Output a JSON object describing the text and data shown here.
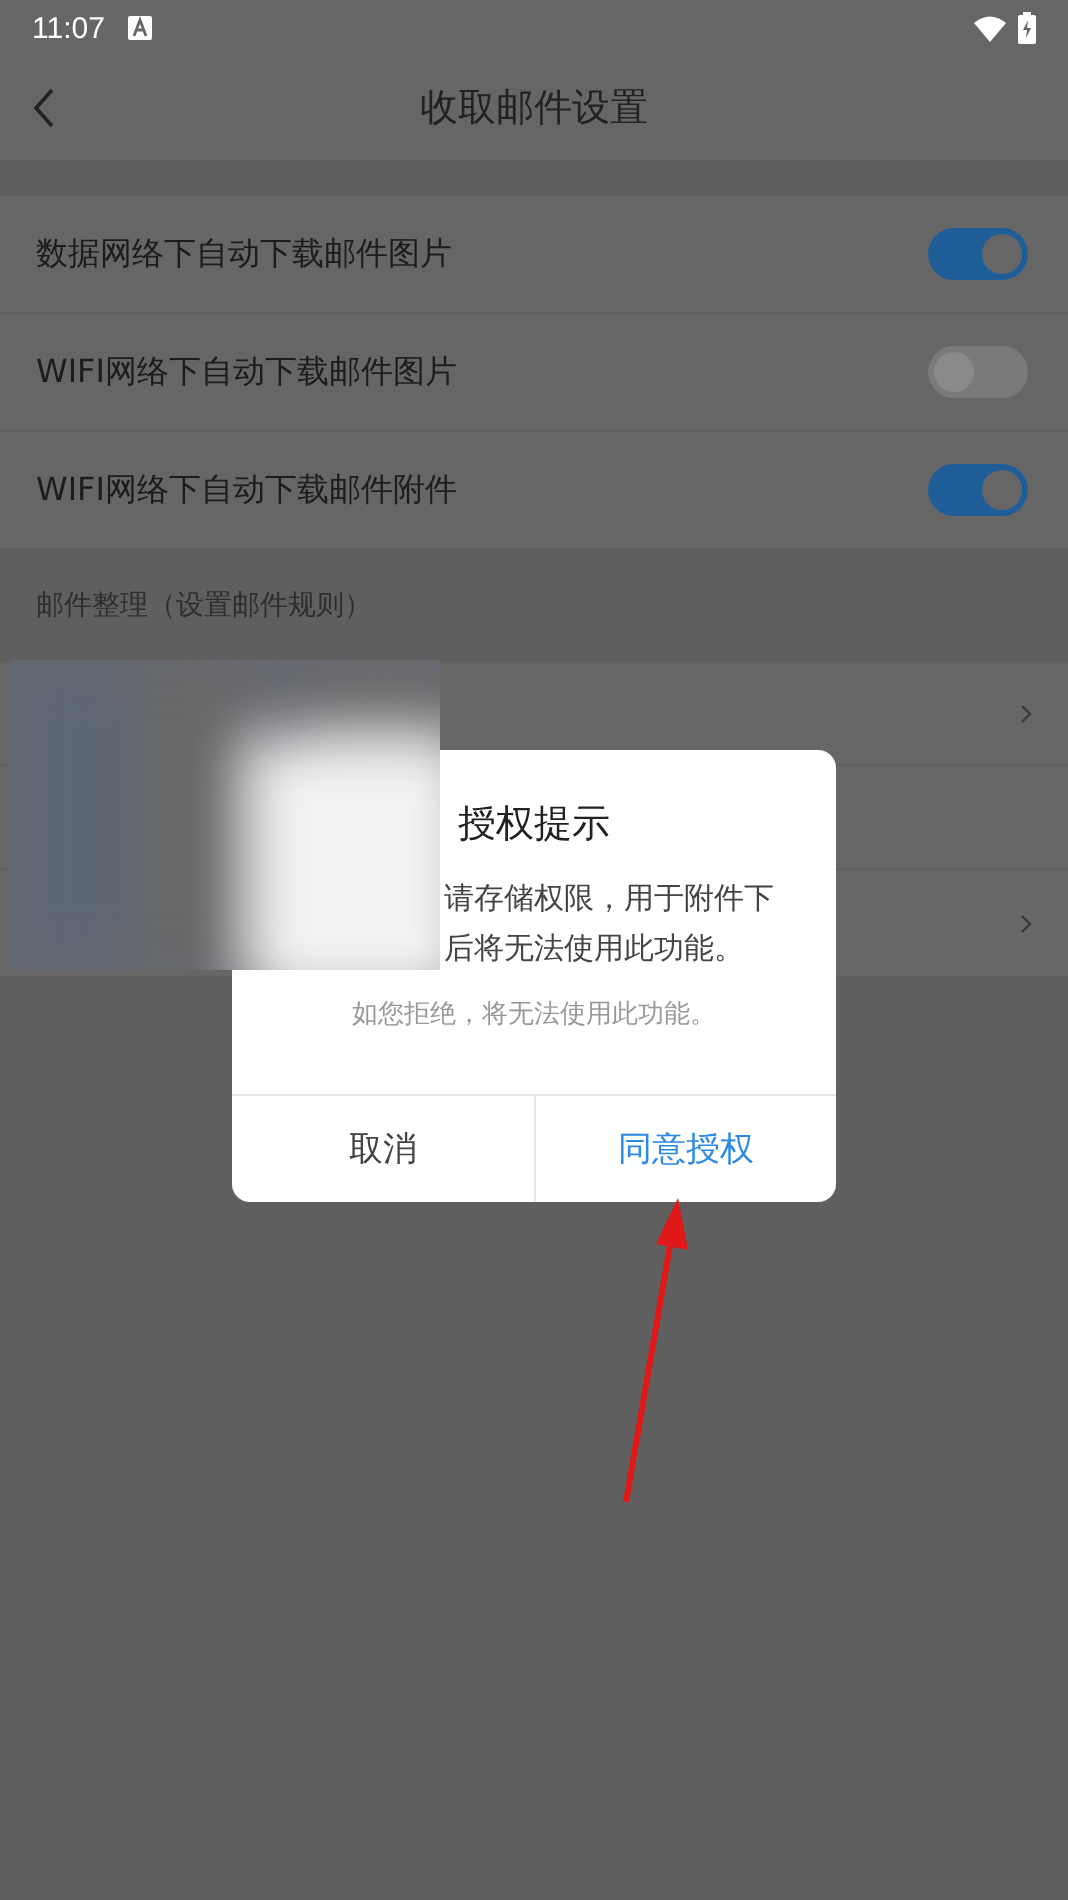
{
  "status_bar": {
    "time": "11:07"
  },
  "header": {
    "title": "收取邮件设置"
  },
  "toggles": [
    {
      "label": "数据网络下自动下载邮件图片",
      "on": true
    },
    {
      "label": "WIFI网络下自动下载邮件图片",
      "on": false
    },
    {
      "label": "WIFI网络下自动下载邮件附件",
      "on": true
    }
  ],
  "section": {
    "title": "邮件整理（设置邮件规则）"
  },
  "rule_rows": [
    {
      "kind": "link"
    },
    {
      "kind": "plain"
    },
    {
      "kind": "link"
    }
  ],
  "dialog": {
    "title": "授权提示",
    "message_lines": [
      "请存储权限，用于附件下",
      "后将无法使用此功能。"
    ],
    "note": "如您拒绝，将无法使用此功能。",
    "buttons": [
      {
        "label": "取消",
        "kind": "cancel"
      },
      {
        "label": "同意授权",
        "kind": "confirm"
      }
    ]
  }
}
